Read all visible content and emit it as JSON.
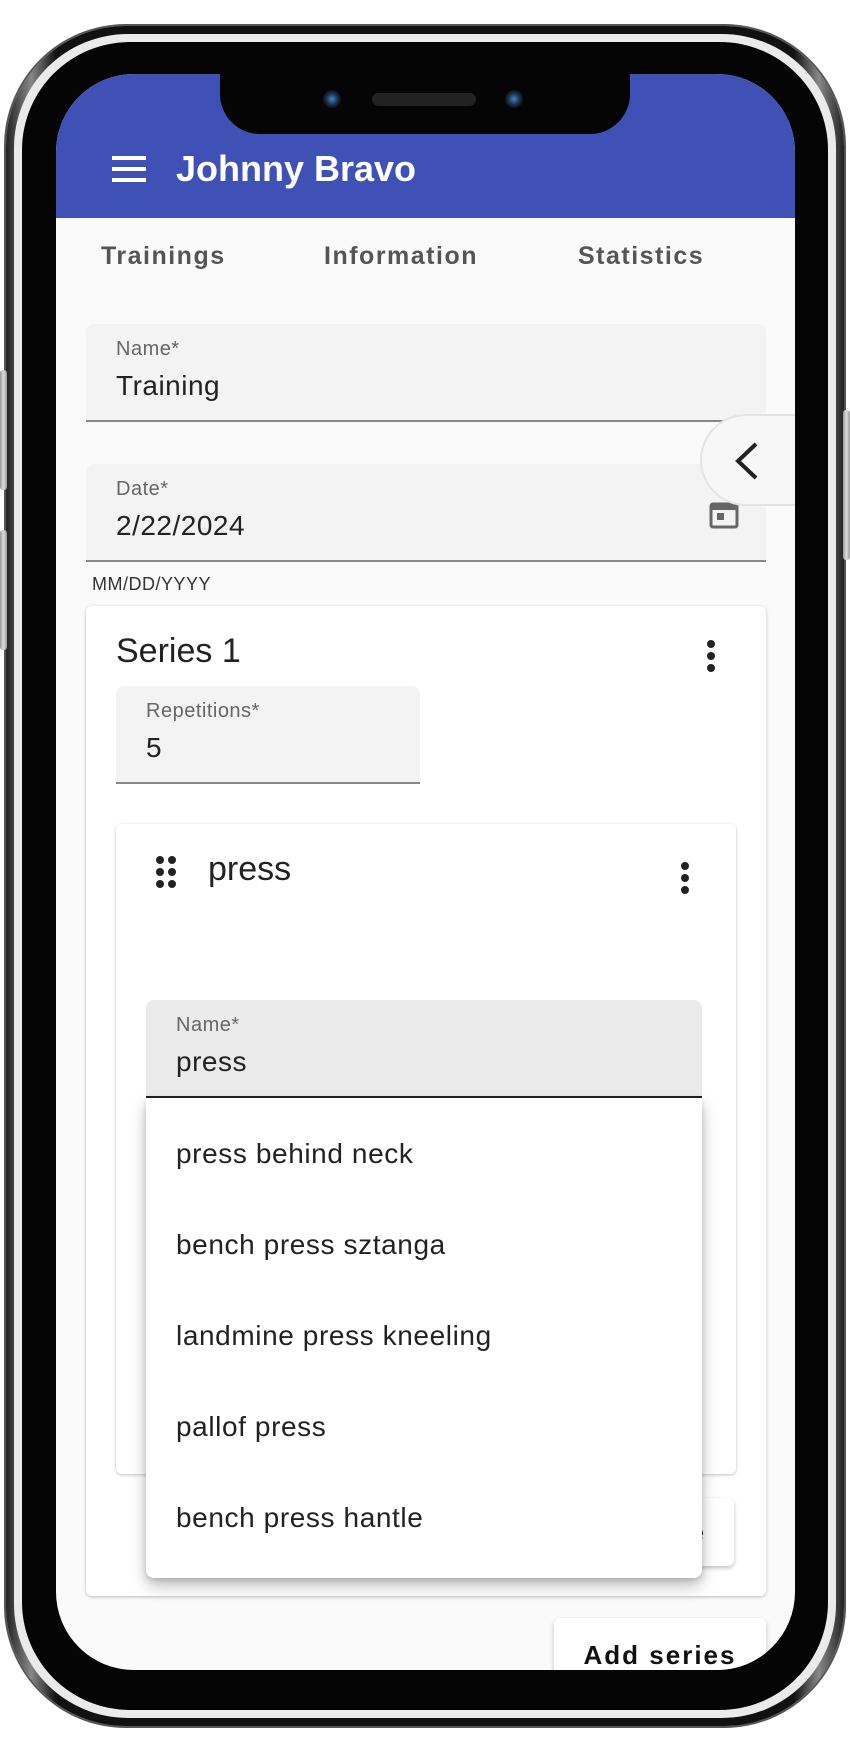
{
  "app": {
    "title": "Johnny Bravo",
    "header_color": "#3f51b5"
  },
  "tabs": [
    {
      "label": "Trainings"
    },
    {
      "label": "Information"
    },
    {
      "label": "Statistics"
    }
  ],
  "form": {
    "name_label": "Name*",
    "name_value": "Training",
    "date_label": "Date*",
    "date_value": "2/22/2024",
    "date_helper": "MM/DD/YYYY"
  },
  "series": {
    "title": "Series 1",
    "repetitions_label": "Repetitions*",
    "repetitions_value": "5",
    "exercise": {
      "title": "press",
      "name_label": "Name*",
      "name_value": "press"
    },
    "add_exercise_label": "Add exercise"
  },
  "autocomplete": {
    "options": [
      "press behind neck",
      "bench press sztanga",
      "landmine press kneeling",
      "pallof press",
      "bench press hantle"
    ]
  },
  "add_series_label": "Add series",
  "icons": {
    "menu": "hamburger-menu-icon",
    "calendar": "calendar-icon",
    "collapse": "chevron-left-icon",
    "more": "more-vert-icon",
    "drag": "drag-handle-icon"
  }
}
